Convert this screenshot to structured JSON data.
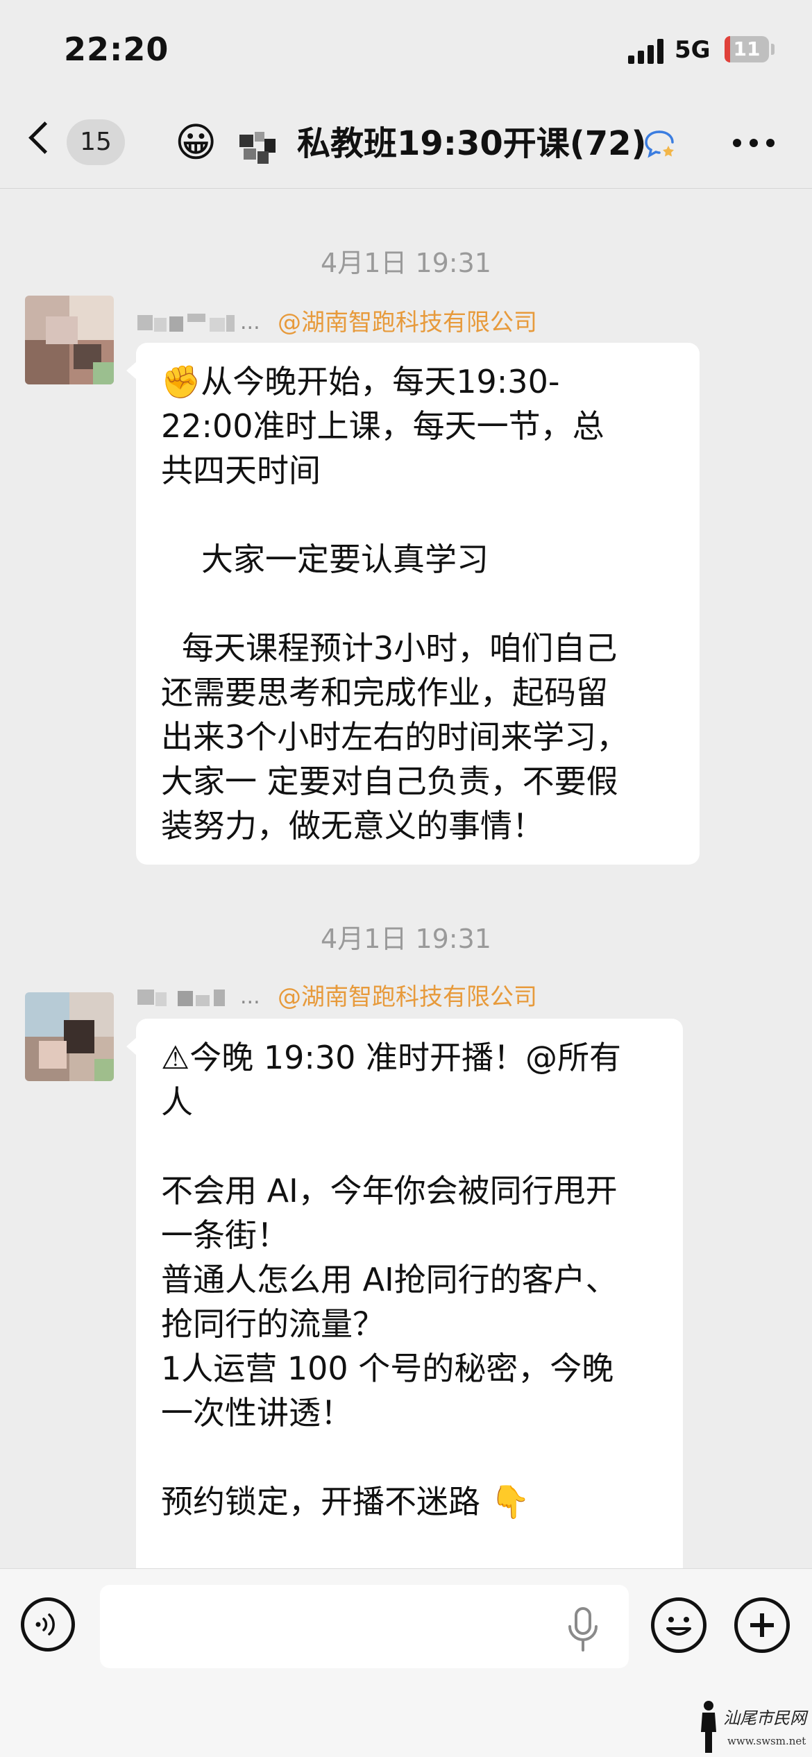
{
  "status_bar": {
    "time": "22:20",
    "network": "5G",
    "battery_percent": "11",
    "battery_fraction": 0.11,
    "battery_color": "#e0413a"
  },
  "nav_bar": {
    "back_icon": "chevron-left-icon",
    "unread_count": "15",
    "group_emoji": "😀",
    "title": "私教班19:30开课(72)",
    "group_icon": "group-chat-icon",
    "more_icon": "ellipsis-icon"
  },
  "messages": [
    {
      "timestamp": "4月1日 19:31",
      "sender_ellipsis": "...",
      "sender_company": "@湖南智跑科技有限公司",
      "lines": [
        "✊从今晚开始，每天19:30-",
        "22:00准时上课，每天一节，总",
        "共四天时间",
        "",
        "大家一定要认真学习",
        "",
        "每天课程预计3小时，咱们自己",
        "还需要思考和完成作业，起码留",
        "出来3个小时左右的时间来学习，",
        "大家一 定要对自己负责，不要假",
        "装努力，做无意义的事情！"
      ]
    },
    {
      "timestamp": "4月1日 19:31",
      "sender_ellipsis": "...",
      "sender_company": "@湖南智跑科技有限公司",
      "lines": [
        "⚠今晚 19:30 准时开播！@所有",
        "人",
        "",
        "不会用 AI，今年你会被同行甩开",
        "一条街！",
        "普通人怎么用 AI抢同行的客户、",
        "抢同行的流量？",
        "1人运营 100 个号的秘密，今晚",
        "一次性讲透！",
        "",
        "预约锁定，开播不迷路 👇"
      ]
    }
  ],
  "input_bar": {
    "voice_icon": "voice-icon",
    "mic_icon": "microphone-icon",
    "emoji_icon": "emoji-icon",
    "plus_icon": "plus-icon"
  },
  "watermark": {
    "title": "汕尾市民网",
    "url": "www.swsm.net"
  },
  "colors": {
    "background": "#ededed",
    "bubble": "#ffffff",
    "company_tag": "#e79a3b",
    "timestamp": "#9a9a9a"
  }
}
